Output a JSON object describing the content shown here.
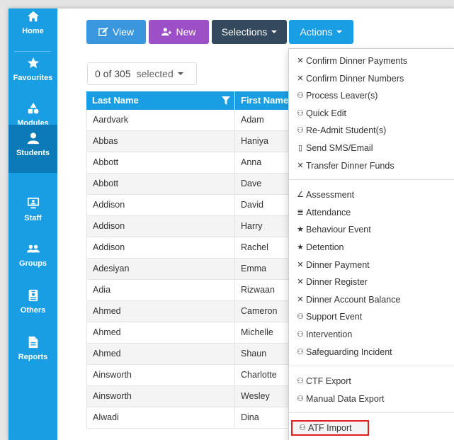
{
  "sidebar": {
    "items": [
      {
        "label": "Home",
        "icon": "home-icon"
      },
      {
        "label": "Favourites",
        "icon": "star-icon"
      },
      {
        "label": "Modules",
        "icon": "shapes-icon"
      },
      {
        "label": "Students",
        "icon": "user-icon"
      },
      {
        "label": "Staff",
        "icon": "monitor-user-icon"
      },
      {
        "label": "Groups",
        "icon": "group-icon"
      },
      {
        "label": "Others",
        "icon": "badge-icon"
      },
      {
        "label": "Reports",
        "icon": "file-icon"
      }
    ],
    "active": "Students",
    "color": "#1a9ee3",
    "active_color": "#0d7ab8"
  },
  "toolbar": {
    "view_label": "View",
    "new_label": "New",
    "selections_label": "Selections",
    "actions_label": "Actions"
  },
  "selection": {
    "count_text": "0 of 305",
    "selected_label": "selected"
  },
  "table": {
    "columns": [
      "Last Name",
      "First Name"
    ],
    "rows": [
      [
        "Aardvark",
        "Adam"
      ],
      [
        "Abbas",
        "Haniya"
      ],
      [
        "Abbott",
        "Anna"
      ],
      [
        "Abbott",
        "Dave"
      ],
      [
        "Addison",
        "David"
      ],
      [
        "Addison",
        "Harry"
      ],
      [
        "Addison",
        "Rachel"
      ],
      [
        "Adesiyan",
        "Emma"
      ],
      [
        "Adia",
        "Rizwaan"
      ],
      [
        "Ahmed",
        "Cameron"
      ],
      [
        "Ahmed",
        "Michelle"
      ],
      [
        "Ahmed",
        "Shaun"
      ],
      [
        "Ainsworth",
        "Charlotte"
      ],
      [
        "Ainsworth",
        "Wesley"
      ],
      [
        "Alwadi",
        "Dina"
      ]
    ]
  },
  "actions_menu": {
    "groups": [
      [
        {
          "label": "Confirm Dinner Payments",
          "icon": "cutlery-icon"
        },
        {
          "label": "Confirm Dinner Numbers",
          "icon": "cutlery-icon"
        },
        {
          "label": "Process Leaver(s)",
          "icon": "group-icon"
        },
        {
          "label": "Quick Edit",
          "icon": "group-icon"
        },
        {
          "label": "Re-Admit Student(s)",
          "icon": "group-icon"
        },
        {
          "label": "Send SMS/Email",
          "icon": "mobile-icon"
        },
        {
          "label": "Transfer Dinner Funds",
          "icon": "cutlery-icon"
        }
      ],
      [
        {
          "label": "Assessment",
          "icon": "pencil-icon"
        },
        {
          "label": "Attendance",
          "icon": "check-list-icon"
        },
        {
          "label": "Behaviour Event",
          "icon": "star-icon"
        },
        {
          "label": "Detention",
          "icon": "star-icon"
        },
        {
          "label": "Dinner Payment",
          "icon": "cutlery-icon"
        },
        {
          "label": "Dinner Register",
          "icon": "cutlery-icon"
        },
        {
          "label": "Dinner Account Balance",
          "icon": "cutlery-icon"
        },
        {
          "label": "Support Event",
          "icon": "group-icon"
        },
        {
          "label": "Intervention",
          "icon": "group-icon"
        },
        {
          "label": "Safeguarding Incident",
          "icon": "group-icon"
        }
      ],
      [
        {
          "label": "CTF Export",
          "icon": "group-icon"
        },
        {
          "label": "Manual Data Export",
          "icon": "group-icon"
        }
      ],
      [
        {
          "label": "ATF Import",
          "icon": "group-icon",
          "highlighted": true
        }
      ]
    ]
  },
  "colors": {
    "view": "#3a97dd",
    "new": "#9c4fc7",
    "selections": "#34495e",
    "actions": "#1a9ee3",
    "highlight_border": "#e01e1e"
  }
}
